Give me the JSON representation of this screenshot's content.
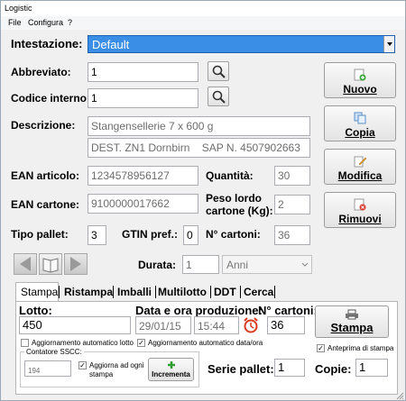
{
  "window": {
    "title": "Logistic"
  },
  "menu": {
    "file": "File",
    "config": "Configura",
    "help": "?"
  },
  "header": {
    "label": "Intestazione:",
    "value": "Default"
  },
  "fields": {
    "abbreviato": {
      "label": "Abbreviato:",
      "value": "1"
    },
    "codice": {
      "label": "Codice interno:",
      "value": "1"
    },
    "descrizione": {
      "label": "Descrizione:",
      "line1": "Stangensellerie 7 x 600 g",
      "line2": "DEST. ZN1 Dornbirn    SAP N. 4507902663"
    },
    "ean_articolo": {
      "label": "EAN articolo:",
      "value": "1234578956127"
    },
    "quantita": {
      "label": "Quantità:",
      "value": "30"
    },
    "ean_cartone": {
      "label": "EAN cartone:",
      "value": "9100000017662"
    },
    "peso": {
      "label1": "Peso lordo",
      "label2": "cartone (Kg):",
      "value": "2"
    },
    "tipo_pallet": {
      "label": "Tipo pallet:",
      "value": "3"
    },
    "gtin": {
      "label": "GTIN pref.:",
      "value": "0"
    },
    "n_cartoni": {
      "label": "N° cartoni:",
      "value": "36"
    },
    "durata": {
      "label": "Durata:",
      "value": "1",
      "unit": "Anni"
    }
  },
  "side_buttons": {
    "nuovo": "Nuovo",
    "copia": "Copia",
    "modifica": "Modifica",
    "rimuovi": "Rimuovi"
  },
  "tabs": [
    "Stampa",
    "Ristampa",
    "Imballi",
    "Multilotto",
    "DDT",
    "Cerca"
  ],
  "stampa": {
    "lotto_label": "Lotto:",
    "lotto_value": "450",
    "data_label": "Data e ora produzione:",
    "data_value": "29/01/15",
    "ora_value": "15:44",
    "cartoni_label": "N° cartoni:",
    "cartoni_value": "36",
    "stampa_button": "Stampa",
    "agg_lotto": "Aggiornamento automatico lotto",
    "agg_data": "Aggiornamento automatico data/ora",
    "anteprima": "Anteprima di stampa",
    "sscc_legend": "Contatore SSCC:",
    "sscc_value": "194",
    "agg_ogni_1": "Aggiorna ad ogni",
    "agg_ogni_2": "stampa",
    "incrementa": "Incrementa",
    "serie_label": "Serie pallet:",
    "serie_value": "1",
    "copie_label": "Copie:",
    "copie_value": "1"
  },
  "colors": {
    "accent": "#3399ff",
    "selection": "#3a8ee6",
    "alarm": "#d93a20"
  }
}
